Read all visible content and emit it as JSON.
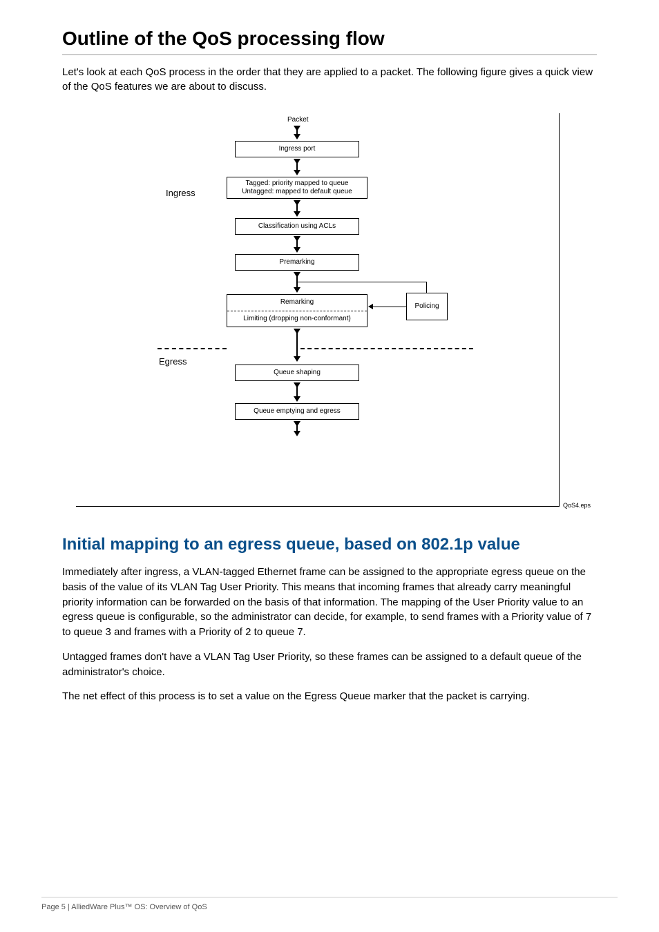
{
  "h1": "Outline of the QoS processing flow",
  "intro": "Let's look at each QoS process in the order that they are applied to a packet. The following figure gives a quick view of the QoS features we are about to discuss.",
  "diagram": {
    "packet": "Packet",
    "ingress_port": "Ingress port",
    "tagged": "Tagged: priority mapped to queue\nUntagged: mapped to default queue",
    "classification": "Classification using ACLs",
    "premarking": "Premarking",
    "remarking": "Remarking",
    "limiting": "Limiting (dropping non-conformant)",
    "policing": "Policing",
    "queue_shaping": "Queue shaping",
    "queue_empty": "Queue emptying and egress",
    "ingress_label": "Ingress",
    "egress_label": "Egress",
    "caption": "QoS4.eps"
  },
  "h2": "Initial mapping to an egress queue, based on 802.1p value",
  "para1": "Immediately after ingress, a VLAN-tagged Ethernet frame can be assigned to the appropriate egress queue on the basis of the value of its VLAN Tag User Priority. This means that incoming frames that already carry meaningful priority information can be forwarded on the basis of that information. The mapping of the User Priority value to an egress queue is configurable, so the administrator can decide, for example, to send frames with a Priority value of 7 to queue 3 and frames with a Priority of 2 to queue 7.",
  "para2": "Untagged frames don't have a VLAN Tag User Priority, so these frames can be assigned to a default queue of the administrator's choice.",
  "para3": "The net effect of this process is to set a value on the Egress Queue marker that the packet is carrying.",
  "footer": "Page 5 | AlliedWare Plus™ OS: Overview of QoS"
}
